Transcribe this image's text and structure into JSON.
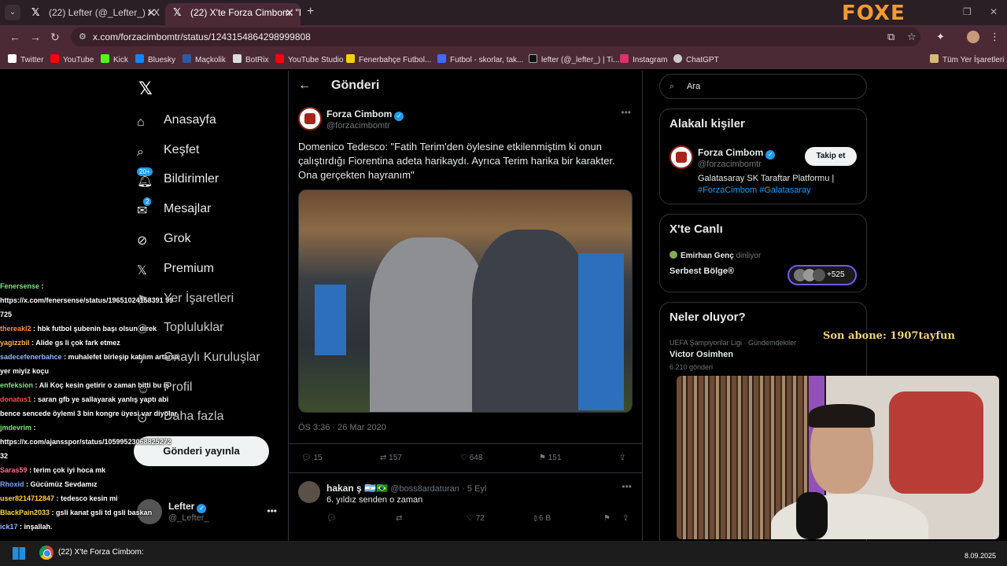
{
  "browser": {
    "tabs": [
      {
        "title": "(22) Lefter (@_Lefter_) / X"
      },
      {
        "title": "(22) X'te Forza Cimbom: \"Dom"
      }
    ],
    "url": "x.com/forzacimbomtr/status/1243154864298999808",
    "brand_overlay": "FOXE",
    "bookmarks": [
      "Twitter",
      "YouTube",
      "Kick",
      "Bluesky",
      "Maçkolik",
      "BotRix",
      "YouTube Studio",
      "Fenerbahçe Futbol...",
      "Futbol - skorlar, tak...",
      "lefter (@_lefter_) | Ti...",
      "Instagram",
      "ChatGPT"
    ],
    "all_bookmarks": "Tüm Yer İşaretleri"
  },
  "nav": {
    "items": [
      {
        "label": "Anasayfa",
        "icon": "home-icon"
      },
      {
        "label": "Keşfet",
        "icon": "search-icon"
      },
      {
        "label": "Bildirimler",
        "icon": "bell-icon",
        "badge": "20+"
      },
      {
        "label": "Mesajlar",
        "icon": "mail-icon",
        "badge": "2"
      },
      {
        "label": "Grok",
        "icon": "grok-icon"
      },
      {
        "label": "Premium",
        "icon": "x-icon"
      },
      {
        "label": "Yer İşaretleri",
        "icon": "bookmark-icon"
      },
      {
        "label": "Topluluklar",
        "icon": "people-icon"
      },
      {
        "label": "Onaylı Kuruluşlar",
        "icon": "lightning-icon"
      },
      {
        "label": "Profil",
        "icon": "person-icon"
      },
      {
        "label": "Daha fazla",
        "icon": "more-circle-icon"
      }
    ],
    "post_button": "Gönderi yayınla",
    "account": {
      "name": "Lefter",
      "handle": "@_Lefter_"
    }
  },
  "main": {
    "title": "Gönderi",
    "tweet": {
      "author": "Forza Cimbom",
      "handle": "@forzacimbomtr",
      "text": "Domenico Tedesco: \"Fatih Terim'den öylesine etkilenmiştim ki onun çalıştırdığı Fiorentina adeta harikaydı. Ayrıca Terim harika bir karakter. Ona gerçekten hayranım\"",
      "time": "ÖS 3:36 · 26 Mar 2020",
      "replies": "15",
      "retweets": "157",
      "likes": "648",
      "bookmarks": "151"
    },
    "reply": {
      "author": "hakan ş 🇦🇷🇧🇷",
      "handle": "@boss8ardaturan",
      "date": "· 5 Eyl",
      "text": "6. yıldız senden o zaman",
      "likes": "72",
      "views": "6 B"
    }
  },
  "sidebar": {
    "search_placeholder": "Ara",
    "related_title": "Alakalı kişiler",
    "related": {
      "name": "Forza Cimbom",
      "handle": "@forzacimbomtr",
      "bio": "Galatasaray SK Taraftar Platformu |",
      "tags": "#ForzaCimbom #Galatasaray",
      "follow": "Takip et"
    },
    "live_title": "X'te Canlı",
    "live": {
      "host": "Emirhan Genç",
      "status": "dinliyor",
      "space": "Serbest Bölge®",
      "count": "+525"
    },
    "trends_title": "Neler oluyor?",
    "trend": {
      "category": "UEFA Şampiyonlar Ligi · Gündemdekiler",
      "name": "Victor Osimhen",
      "count": "6.210 gönderi"
    }
  },
  "stream": {
    "subscriber_banner": "Son abone: 1907tayfun",
    "chat": [
      {
        "user": "Fenersense",
        "color": "#7ee37e",
        "msg": ":"
      },
      {
        "user": "",
        "color": "#ffffff",
        "msg": "https://x.com/fenersense/status/19651024158391 99"
      },
      {
        "user": "",
        "color": "#ffffff",
        "msg": "725"
      },
      {
        "user": "thereakl2",
        "color": "#ff8c42",
        "msg": ": hbk futbol şubenin başı olsun direk"
      },
      {
        "user": "yagizzbil",
        "color": "#ffb347",
        "msg": ": Alide gs li çok fark etmez"
      },
      {
        "user": "sadecefenerbahce",
        "color": "#8fb8ff",
        "msg": ": muhalefet birleşip katılım artarsa"
      },
      {
        "user": "",
        "color": "#ffffff",
        "msg": "yer miyiz koçu"
      },
      {
        "user": "enfeksion",
        "color": "#7ee37e",
        "msg": ": Ali Koç kesin getirir o zaman bitti bu iş"
      },
      {
        "user": "donatus1",
        "color": "#ff4d4d",
        "msg": ": saran gfb ye sallayarak yanlış yaptı abi"
      },
      {
        "user": "",
        "color": "#ffffff",
        "msg": "bence sencede öylemi 3 bin kongre üyesi var diyolar"
      },
      {
        "user": "jmdevrim",
        "color": "#7ee37e",
        "msg": ":"
      },
      {
        "user": "",
        "color": "#ffffff",
        "msg": "https://x.com/ajansspor/status/10599523068825272"
      },
      {
        "user": "",
        "color": "#ffffff",
        "msg": "32"
      },
      {
        "user": "Saras59",
        "color": "#ff6b8a",
        "msg": ": terim çok iyi hoca mk"
      },
      {
        "user": "Rhoxid",
        "color": "#7aa7ff",
        "msg": ": Gücümüz Sevdamız"
      },
      {
        "user": "user8214712847",
        "color": "#ffd24d",
        "msg": ": tedesco kesin mi"
      },
      {
        "user": "BlackPain2033",
        "color": "#ffd24d",
        "msg": ": gsli kanat gsli td gsli baskan"
      },
      {
        "user": "ick17",
        "color": "#8fb8ff",
        "msg": ": inşallah."
      }
    ]
  },
  "taskbar": {
    "window_title": "(22) X'te Forza Cimbom:",
    "date": "8.09.2025"
  }
}
